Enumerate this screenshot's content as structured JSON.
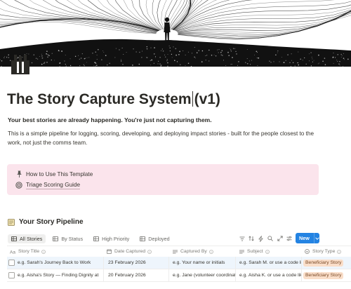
{
  "page": {
    "title": "The Story Capture System",
    "title_suffix": "(v1)",
    "subtitle": "Your best stories are already happening. You're just not capturing them.",
    "description": "This is a simple pipeline for logging, scoring, developing, and deploying impact stories - built for the people closest to the work, not just the comms team."
  },
  "callout": {
    "items": [
      {
        "label": "How to Use This Template",
        "icon": "pushpin-icon"
      },
      {
        "label": "Triage Scoring Guide",
        "icon": "target-icon"
      }
    ]
  },
  "database": {
    "title": "Your Story Pipeline",
    "icon": "notepad-icon",
    "views": [
      {
        "label": "All Stories",
        "icon": "table-icon",
        "active": true
      },
      {
        "label": "By Status",
        "icon": "table-icon",
        "active": false
      },
      {
        "label": "High Priority",
        "icon": "table-icon",
        "active": false
      },
      {
        "label": "Deployed",
        "icon": "table-icon",
        "active": false
      }
    ],
    "toolbar": {
      "icons": [
        "filter-icon",
        "sort-icon",
        "automation-icon",
        "search-icon",
        "expand-icon",
        "settings-icon",
        "more-icon"
      ],
      "new_label": "New"
    },
    "columns": [
      {
        "label": "Story Title",
        "icon": "text-icon"
      },
      {
        "label": "Date Captured",
        "icon": "calendar-icon"
      },
      {
        "label": "Captured By",
        "icon": "text-icon"
      },
      {
        "label": "Subject",
        "icon": "text-icon"
      },
      {
        "label": "Story Type",
        "icon": "select-icon"
      }
    ],
    "rows": [
      {
        "title": "e.g. Sarah's Journey Back to Work",
        "date": "23 February 2026",
        "captured_by": "e.g. Your name or initials",
        "subject": "e.g. Sarah M. or use a code like",
        "type": "Beneficiary Story"
      },
      {
        "title": "e.g. Aisha's Story — Finding Dignity at",
        "date": "20 February 2026",
        "captured_by": "e.g. Jane (volunteer coordinat",
        "subject": "e.g. Aisha K. or use a code lik",
        "type": "Beneficiary Story"
      }
    ]
  },
  "colors": {
    "accent": "#2383e2",
    "callout_bg": "#fbe4ec",
    "badge_bg": "#fadec9",
    "selected_row": "#eef5fc"
  }
}
